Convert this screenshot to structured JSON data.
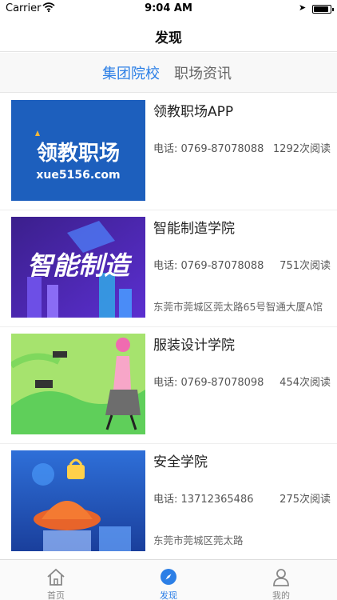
{
  "status_bar": {
    "carrier": "Carrier",
    "time": "9:04 AM",
    "battery_level": 0.9
  },
  "nav": {
    "title": "发现"
  },
  "segment_tabs": [
    {
      "label": "集团院校",
      "active": true
    },
    {
      "label": "职场资讯",
      "active": false
    }
  ],
  "schools": [
    {
      "title": "领教职场APP",
      "phone": "电话: 0769-87078088",
      "reads": "1292次阅读",
      "address": "",
      "logo_text": "领教职场",
      "logo_sub": "xue5156.com"
    },
    {
      "title": "智能制造学院",
      "phone": "电话: 0769-87078088",
      "reads": "751次阅读",
      "address": "东莞市莞城区莞太路65号智通大厦A馆",
      "banner_text": "智能制造"
    },
    {
      "title": "服装设计学院",
      "phone": "电话: 0769-87078098",
      "reads": "454次阅读",
      "address": ""
    },
    {
      "title": "安全学院",
      "phone": "电话: 13712365486",
      "reads": "275次阅读",
      "address": "东莞市莞城区莞太路"
    }
  ],
  "tabbar": [
    {
      "label": "首页",
      "icon": "home-icon",
      "active": false
    },
    {
      "label": "发现",
      "icon": "compass-icon",
      "active": true
    },
    {
      "label": "我的",
      "icon": "user-icon",
      "active": false
    }
  ],
  "colors": {
    "accent": "#2c7fe6",
    "logo_bg": "#1d5fbd"
  }
}
